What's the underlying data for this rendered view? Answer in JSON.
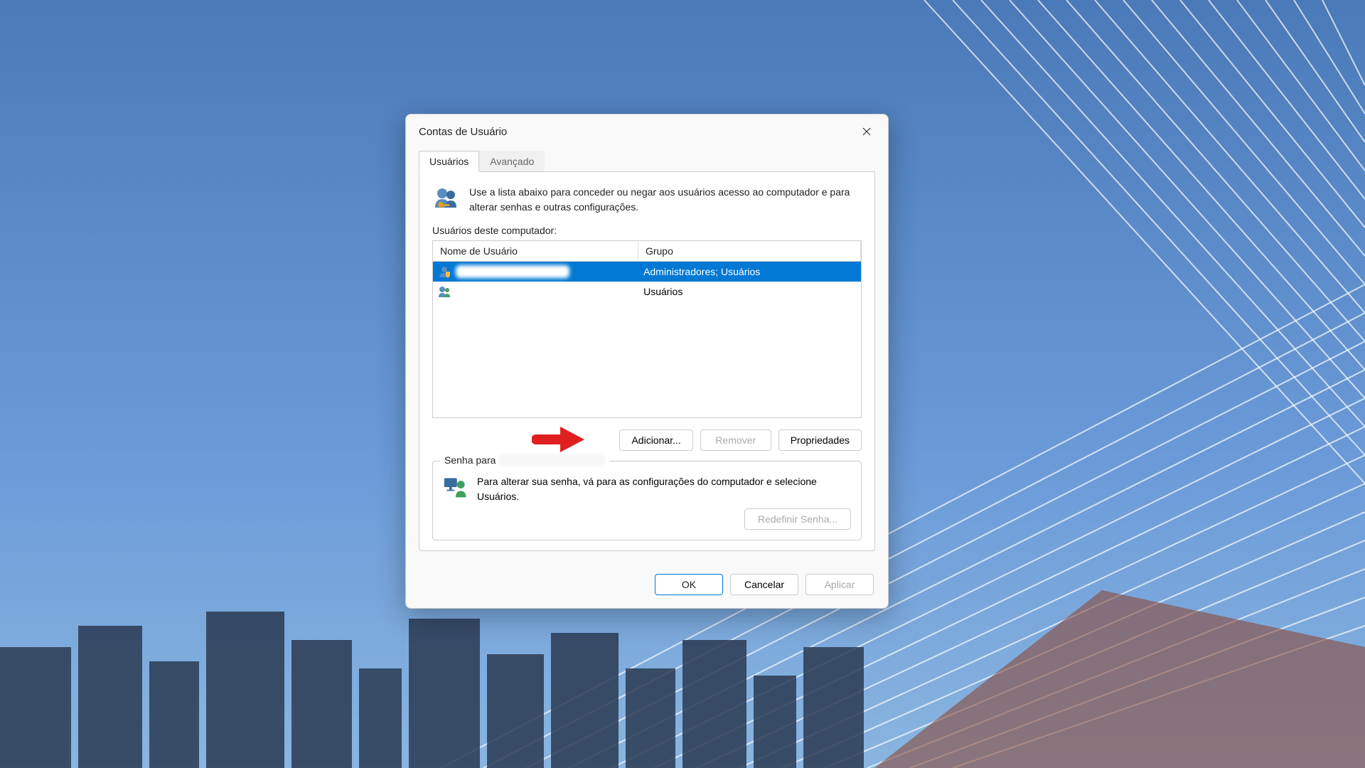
{
  "dialog": {
    "title": "Contas de Usuário",
    "tabs": {
      "users": "Usuários",
      "advanced": "Avançado"
    },
    "intro": "Use a lista abaixo para conceder ou negar aos usuários acesso ao computador e para alterar senhas e outras configurações.",
    "list_label": "Usuários deste computador:",
    "columns": {
      "username": "Nome de Usuário",
      "group": "Grupo"
    },
    "rows": [
      {
        "username": "",
        "group": "Administradores; Usuários",
        "selected": true
      },
      {
        "username": "",
        "group": "Usuários",
        "selected": false
      }
    ],
    "buttons": {
      "add": "Adicionar...",
      "remove": "Remover",
      "properties": "Propriedades"
    },
    "password_group": {
      "label_prefix": "Senha para",
      "text": "Para alterar sua senha, vá para as configurações do computador e selecione Usuários.",
      "reset_button": "Redefinir Senha..."
    },
    "footer": {
      "ok": "OK",
      "cancel": "Cancelar",
      "apply": "Aplicar"
    }
  }
}
